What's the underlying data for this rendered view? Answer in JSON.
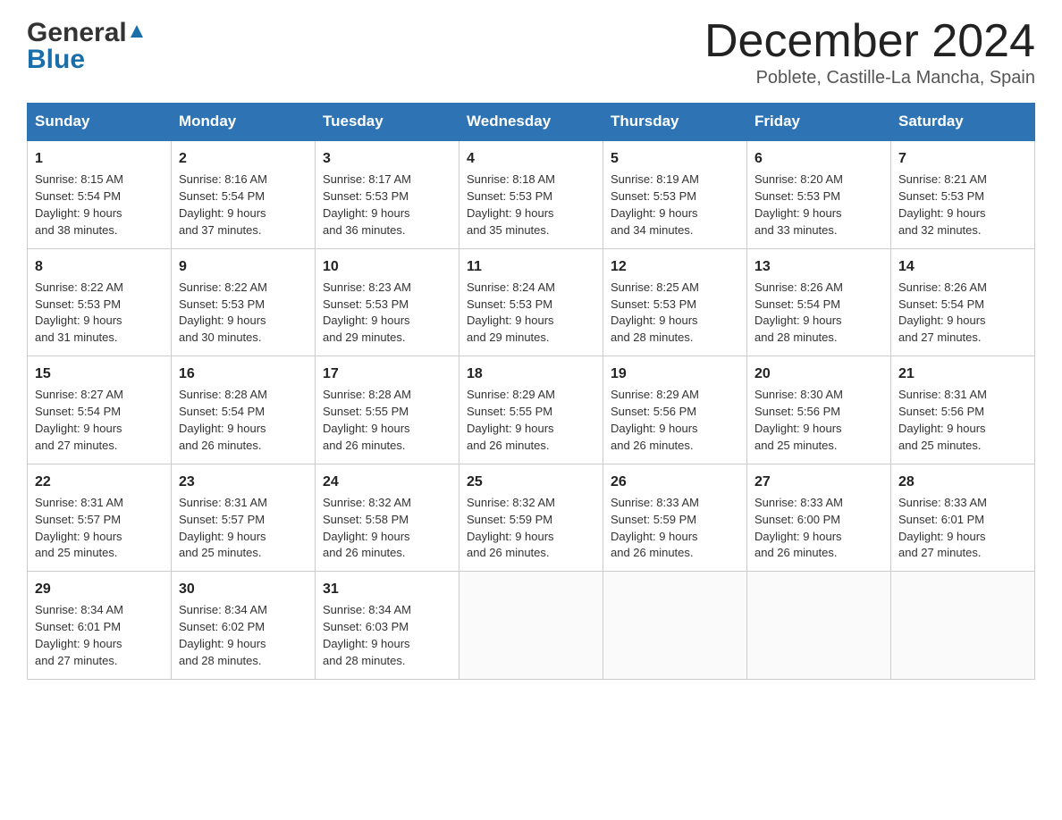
{
  "header": {
    "logo_general": "General",
    "logo_blue": "Blue",
    "month_year": "December 2024",
    "location": "Poblete, Castille-La Mancha, Spain"
  },
  "days_of_week": [
    "Sunday",
    "Monday",
    "Tuesday",
    "Wednesday",
    "Thursday",
    "Friday",
    "Saturday"
  ],
  "weeks": [
    [
      {
        "day": "1",
        "sunrise": "8:15 AM",
        "sunset": "5:54 PM",
        "daylight": "9 hours and 38 minutes."
      },
      {
        "day": "2",
        "sunrise": "8:16 AM",
        "sunset": "5:54 PM",
        "daylight": "9 hours and 37 minutes."
      },
      {
        "day": "3",
        "sunrise": "8:17 AM",
        "sunset": "5:53 PM",
        "daylight": "9 hours and 36 minutes."
      },
      {
        "day": "4",
        "sunrise": "8:18 AM",
        "sunset": "5:53 PM",
        "daylight": "9 hours and 35 minutes."
      },
      {
        "day": "5",
        "sunrise": "8:19 AM",
        "sunset": "5:53 PM",
        "daylight": "9 hours and 34 minutes."
      },
      {
        "day": "6",
        "sunrise": "8:20 AM",
        "sunset": "5:53 PM",
        "daylight": "9 hours and 33 minutes."
      },
      {
        "day": "7",
        "sunrise": "8:21 AM",
        "sunset": "5:53 PM",
        "daylight": "9 hours and 32 minutes."
      }
    ],
    [
      {
        "day": "8",
        "sunrise": "8:22 AM",
        "sunset": "5:53 PM",
        "daylight": "9 hours and 31 minutes."
      },
      {
        "day": "9",
        "sunrise": "8:22 AM",
        "sunset": "5:53 PM",
        "daylight": "9 hours and 30 minutes."
      },
      {
        "day": "10",
        "sunrise": "8:23 AM",
        "sunset": "5:53 PM",
        "daylight": "9 hours and 29 minutes."
      },
      {
        "day": "11",
        "sunrise": "8:24 AM",
        "sunset": "5:53 PM",
        "daylight": "9 hours and 29 minutes."
      },
      {
        "day": "12",
        "sunrise": "8:25 AM",
        "sunset": "5:53 PM",
        "daylight": "9 hours and 28 minutes."
      },
      {
        "day": "13",
        "sunrise": "8:26 AM",
        "sunset": "5:54 PM",
        "daylight": "9 hours and 28 minutes."
      },
      {
        "day": "14",
        "sunrise": "8:26 AM",
        "sunset": "5:54 PM",
        "daylight": "9 hours and 27 minutes."
      }
    ],
    [
      {
        "day": "15",
        "sunrise": "8:27 AM",
        "sunset": "5:54 PM",
        "daylight": "9 hours and 27 minutes."
      },
      {
        "day": "16",
        "sunrise": "8:28 AM",
        "sunset": "5:54 PM",
        "daylight": "9 hours and 26 minutes."
      },
      {
        "day": "17",
        "sunrise": "8:28 AM",
        "sunset": "5:55 PM",
        "daylight": "9 hours and 26 minutes."
      },
      {
        "day": "18",
        "sunrise": "8:29 AM",
        "sunset": "5:55 PM",
        "daylight": "9 hours and 26 minutes."
      },
      {
        "day": "19",
        "sunrise": "8:29 AM",
        "sunset": "5:56 PM",
        "daylight": "9 hours and 26 minutes."
      },
      {
        "day": "20",
        "sunrise": "8:30 AM",
        "sunset": "5:56 PM",
        "daylight": "9 hours and 25 minutes."
      },
      {
        "day": "21",
        "sunrise": "8:31 AM",
        "sunset": "5:56 PM",
        "daylight": "9 hours and 25 minutes."
      }
    ],
    [
      {
        "day": "22",
        "sunrise": "8:31 AM",
        "sunset": "5:57 PM",
        "daylight": "9 hours and 25 minutes."
      },
      {
        "day": "23",
        "sunrise": "8:31 AM",
        "sunset": "5:57 PM",
        "daylight": "9 hours and 25 minutes."
      },
      {
        "day": "24",
        "sunrise": "8:32 AM",
        "sunset": "5:58 PM",
        "daylight": "9 hours and 26 minutes."
      },
      {
        "day": "25",
        "sunrise": "8:32 AM",
        "sunset": "5:59 PM",
        "daylight": "9 hours and 26 minutes."
      },
      {
        "day": "26",
        "sunrise": "8:33 AM",
        "sunset": "5:59 PM",
        "daylight": "9 hours and 26 minutes."
      },
      {
        "day": "27",
        "sunrise": "8:33 AM",
        "sunset": "6:00 PM",
        "daylight": "9 hours and 26 minutes."
      },
      {
        "day": "28",
        "sunrise": "8:33 AM",
        "sunset": "6:01 PM",
        "daylight": "9 hours and 27 minutes."
      }
    ],
    [
      {
        "day": "29",
        "sunrise": "8:34 AM",
        "sunset": "6:01 PM",
        "daylight": "9 hours and 27 minutes."
      },
      {
        "day": "30",
        "sunrise": "8:34 AM",
        "sunset": "6:02 PM",
        "daylight": "9 hours and 28 minutes."
      },
      {
        "day": "31",
        "sunrise": "8:34 AM",
        "sunset": "6:03 PM",
        "daylight": "9 hours and 28 minutes."
      },
      null,
      null,
      null,
      null
    ]
  ],
  "labels": {
    "sunrise": "Sunrise:",
    "sunset": "Sunset:",
    "daylight": "Daylight:"
  }
}
